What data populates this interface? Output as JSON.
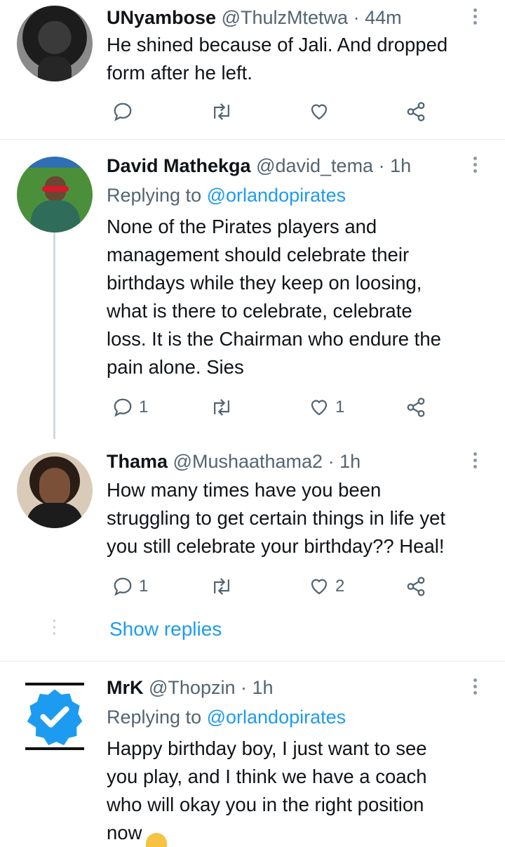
{
  "tweets": [
    {
      "name": "UNyambose",
      "handle": "@ThulzMtetwa",
      "time": "44m",
      "lines": [
        "He shined because of Jali. And dropped",
        "form after he left."
      ],
      "replies": "",
      "likes": ""
    },
    {
      "name": "David Mathekga",
      "handle": "@david_tema",
      "time": "1h",
      "replying_prefix": "Replying to",
      "replying_to": "@orlandopirates",
      "lines": [
        "None of the Pirates players and",
        "management should celebrate their",
        "birthdays while they keep on loosing,",
        "what is there to celebrate, celebrate",
        "loss. It is the Chairman who endure the",
        "pain alone. Sies"
      ],
      "replies": "1",
      "likes": "1"
    },
    {
      "name": "Thama",
      "handle": "@Mushaathama2",
      "time": "1h",
      "lines": [
        "How many times have you been",
        "struggling to get certain things in life yet",
        "you still celebrate your birthday?? Heal!"
      ],
      "replies": "1",
      "likes": "2"
    },
    {
      "name": "MrK",
      "handle": "@Thopzin",
      "time": "1h",
      "replying_prefix": "Replying to",
      "replying_to": "@orlandopirates",
      "lines": [
        "Happy birthday boy, I just want to see",
        "you play, and I think we have a coach",
        "who will okay you in the right position",
        "now"
      ]
    }
  ],
  "show_replies": "Show replies",
  "separator": "·",
  "icons": {
    "reply": "reply-icon",
    "retweet": "retweet-icon",
    "like": "heart-icon",
    "share": "share-icon",
    "more": "more-options-icon"
  },
  "colors": {
    "link": "#1d9bf0",
    "muted": "#536471",
    "text": "#0f1419",
    "verified": "#1d9bf0"
  }
}
